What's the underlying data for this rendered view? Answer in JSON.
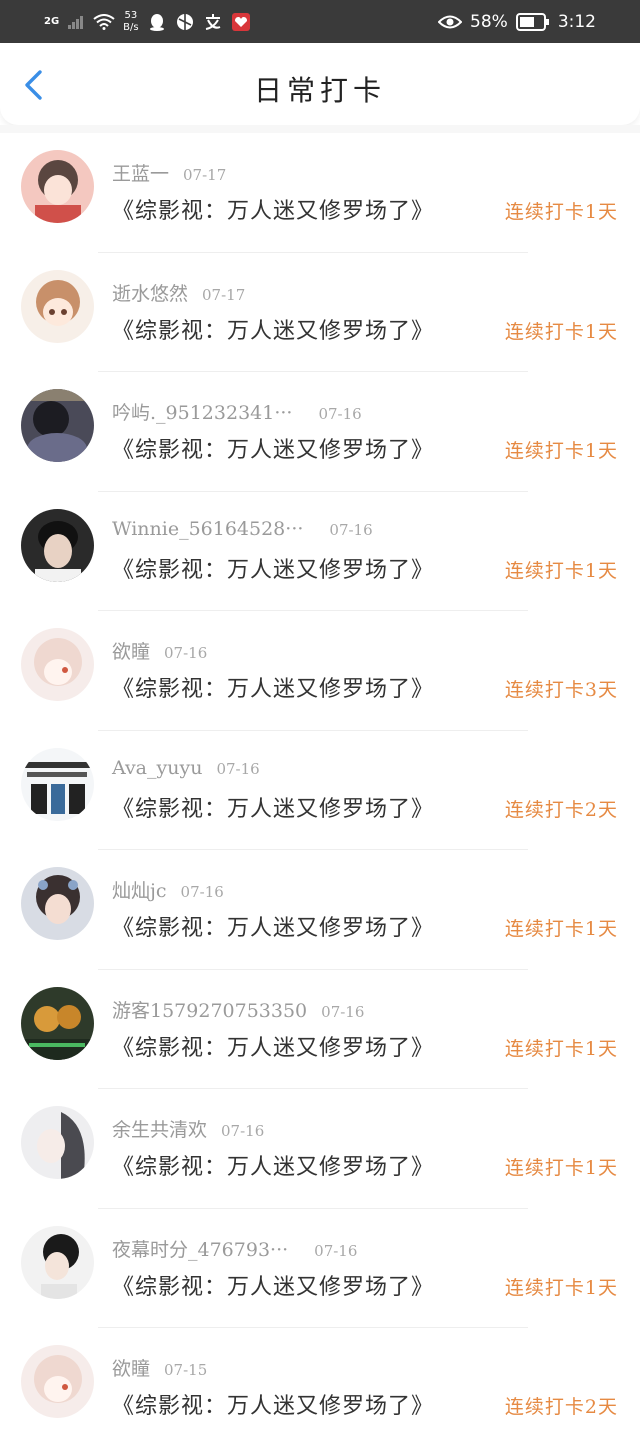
{
  "status_bar": {
    "network": "2G",
    "speed_value": "53",
    "speed_unit": "B/s",
    "battery": "58%",
    "time": "3:12"
  },
  "header": {
    "title": "日常打卡"
  },
  "colors": {
    "accent_back": "#3a8ee6",
    "streak": "#e68a43"
  },
  "items": [
    {
      "name": "王蓝一",
      "date": "07-17",
      "book": "《综影视：万人迷又修罗场了》",
      "streak": "连续打卡1天"
    },
    {
      "name": "逝水悠然",
      "date": "07-17",
      "book": "《综影视：万人迷又修罗场了》",
      "streak": "连续打卡1天"
    },
    {
      "name": "吟屿._951232341···",
      "date": "07-16",
      "book": "《综影视：万人迷又修罗场了》",
      "streak": "连续打卡1天"
    },
    {
      "name": "Winnie_56164528···",
      "date": "07-16",
      "book": "《综影视：万人迷又修罗场了》",
      "streak": "连续打卡1天"
    },
    {
      "name": "欲瞳",
      "date": "07-16",
      "book": "《综影视：万人迷又修罗场了》",
      "streak": "连续打卡3天"
    },
    {
      "name": "Ava_yuyu",
      "date": "07-16",
      "book": "《综影视：万人迷又修罗场了》",
      "streak": "连续打卡2天"
    },
    {
      "name": "灿灿jc",
      "date": "07-16",
      "book": "《综影视：万人迷又修罗场了》",
      "streak": "连续打卡1天"
    },
    {
      "name": "游客1579270753350",
      "date": "07-16",
      "book": "《综影视：万人迷又修罗场了》",
      "streak": "连续打卡1天"
    },
    {
      "name": "余生共清欢",
      "date": "07-16",
      "book": "《综影视：万人迷又修罗场了》",
      "streak": "连续打卡1天"
    },
    {
      "name": "夜幕时分_476793···",
      "date": "07-16",
      "book": "《综影视：万人迷又修罗场了》",
      "streak": "连续打卡1天"
    },
    {
      "name": "欲瞳",
      "date": "07-15",
      "book": "《综影视：万人迷又修罗场了》",
      "streak": "连续打卡2天"
    }
  ]
}
